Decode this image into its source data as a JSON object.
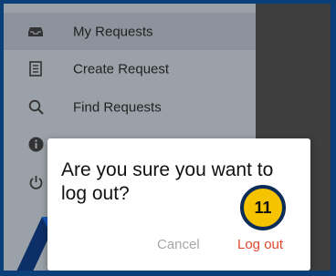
{
  "drawer": {
    "items": [
      {
        "label": "My Requests",
        "icon": "inbox-tray-icon",
        "active": true
      },
      {
        "label": "Create Request",
        "icon": "form-list-icon",
        "active": false
      },
      {
        "label": "Find Requests",
        "icon": "search-icon",
        "active": false
      },
      {
        "label": "",
        "icon": "info-icon",
        "active": false
      },
      {
        "label": "",
        "icon": "power-icon",
        "active": false
      }
    ]
  },
  "dialog": {
    "message": "Are you sure you want to log out?",
    "cancel_label": "Cancel",
    "logout_label": "Log out"
  },
  "badge": {
    "number": "11"
  },
  "colors": {
    "frame": "#0b3f7a",
    "drawer": "#9aa1a8",
    "logout": "#e2472f",
    "cancel": "#a7a7a7",
    "badge": "#f5c300"
  }
}
